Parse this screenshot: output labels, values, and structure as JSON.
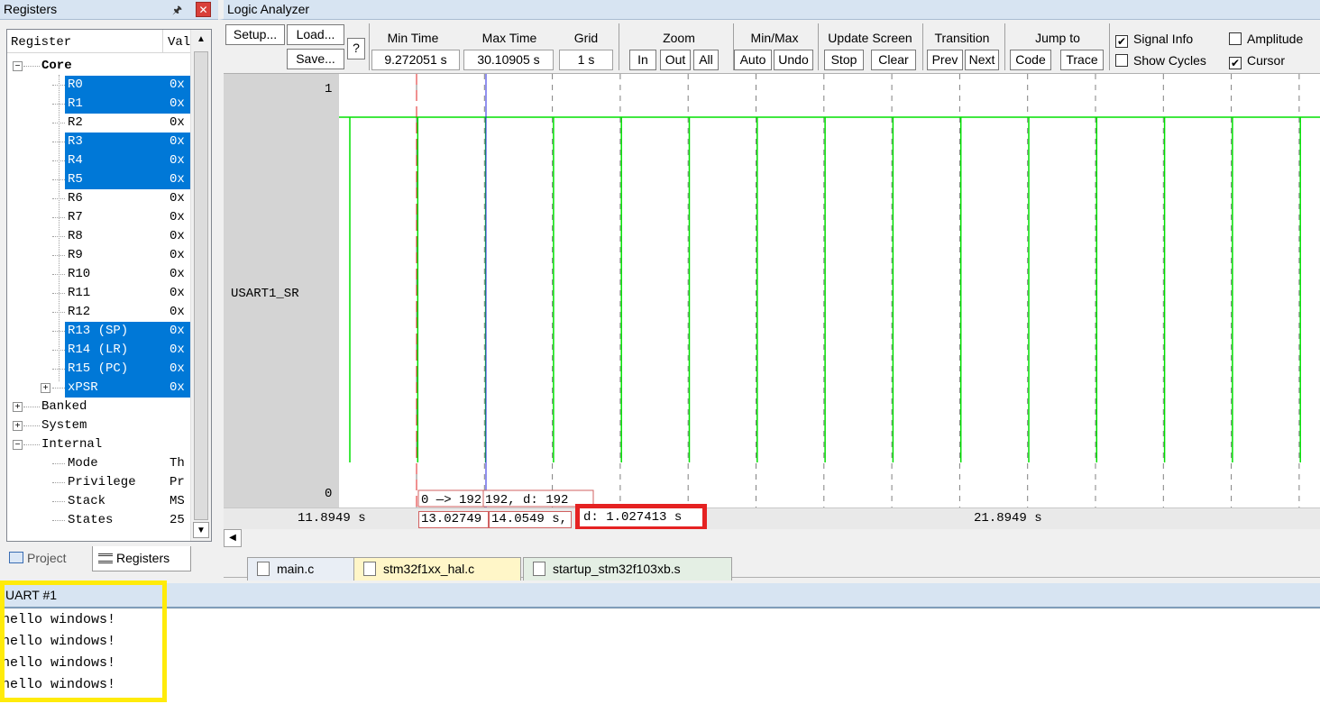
{
  "registers_panel": {
    "title": "Registers",
    "columns": {
      "register": "Register",
      "value": "Value"
    },
    "core_label": "Core",
    "rows": [
      {
        "name": "R0",
        "value": "0x",
        "selected": true
      },
      {
        "name": "R1",
        "value": "0x",
        "selected": true
      },
      {
        "name": "R2",
        "value": "0x",
        "selected": false
      },
      {
        "name": "R3",
        "value": "0x",
        "selected": true
      },
      {
        "name": "R4",
        "value": "0x",
        "selected": true
      },
      {
        "name": "R5",
        "value": "0x",
        "selected": true
      },
      {
        "name": "R6",
        "value": "0x",
        "selected": false
      },
      {
        "name": "R7",
        "value": "0x",
        "selected": false
      },
      {
        "name": "R8",
        "value": "0x",
        "selected": false
      },
      {
        "name": "R9",
        "value": "0x",
        "selected": false
      },
      {
        "name": "R10",
        "value": "0x",
        "selected": false
      },
      {
        "name": "R11",
        "value": "0x",
        "selected": false
      },
      {
        "name": "R12",
        "value": "0x",
        "selected": false
      },
      {
        "name": "R13 (SP)",
        "value": "0x",
        "selected": true
      },
      {
        "name": "R14 (LR)",
        "value": "0x",
        "selected": true
      },
      {
        "name": "R15 (PC)",
        "value": "0x",
        "selected": true
      },
      {
        "name": "xPSR",
        "value": "0x",
        "selected": true
      }
    ],
    "groups": [
      "Banked",
      "System",
      "Internal"
    ],
    "internal_rows": [
      {
        "name": "Mode",
        "value": "Th"
      },
      {
        "name": "Privilege",
        "value": "Pr"
      },
      {
        "name": "Stack",
        "value": "MS"
      },
      {
        "name": "States",
        "value": "25"
      }
    ],
    "tabs": {
      "project": "Project",
      "registers": "Registers"
    }
  },
  "logic_analyzer": {
    "title": "Logic Analyzer",
    "toolbar": {
      "setup": "Setup...",
      "load": "Load...",
      "save": "Save...",
      "help": "?",
      "min_time_label": "Min Time",
      "min_time_value": "9.272051 s",
      "max_time_label": "Max Time",
      "max_time_value": "30.10905 s",
      "grid_label": "Grid",
      "grid_value": "1 s",
      "zoom_label": "Zoom",
      "zoom_in": "In",
      "zoom_out": "Out",
      "zoom_all": "All",
      "minmax_label": "Min/Max",
      "auto": "Auto",
      "undo": "Undo",
      "update_label": "Update Screen",
      "stop": "Stop",
      "clear": "Clear",
      "transition_label": "Transition",
      "prev": "Prev",
      "next": "Next",
      "jumpto_label": "Jump to",
      "code": "Code",
      "trace": "Trace",
      "signal_info": "Signal Info",
      "signal_info_checked": true,
      "amplitude": "Amplitude",
      "amplitude_checked": false,
      "show_cycles": "Show Cycles",
      "show_cycles_checked": false,
      "cursor": "Cursor",
      "cursor_checked": true
    },
    "signal": {
      "name": "USART1_SR",
      "y_max": "1",
      "y_min": "0"
    },
    "time_axis": {
      "left": "11.8949 s",
      "right": "21.8949 s"
    },
    "cursor_info": {
      "transition": "0 —> 192",
      "value_box": "192,   d: 192",
      "t1": "13.02749",
      "t2": "14.0549 s,",
      "delta": "d: 1.027413 s"
    },
    "colors": {
      "signal": "#00e000",
      "cursor_red": "#e02020",
      "cursor_blue": "#2020e0",
      "grid": "#808080"
    }
  },
  "file_tabs": [
    "main.c",
    "stm32f1xx_hal.c",
    "startup_stm32f103xb.s"
  ],
  "uart": {
    "title": "UART #1",
    "lines": [
      "hello windows!",
      "hello windows!",
      "hello windows!",
      "hello windows!"
    ]
  }
}
